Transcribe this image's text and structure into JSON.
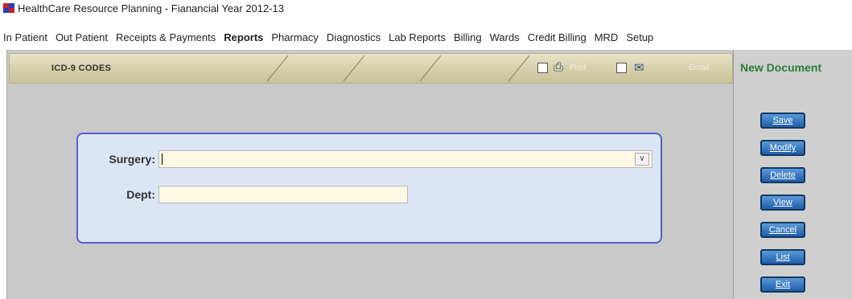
{
  "window": {
    "title": "HealthCare Resource Planning - Fianancial Year 2012-13"
  },
  "menu": [
    {
      "label": "In Patient",
      "bold": false
    },
    {
      "label": "Out Patient",
      "bold": false
    },
    {
      "label": "Receipts & Payments",
      "bold": false
    },
    {
      "label": "Reports",
      "bold": true
    },
    {
      "label": "Pharmacy",
      "bold": false
    },
    {
      "label": "Diagnostics",
      "bold": false
    },
    {
      "label": "Lab Reports",
      "bold": false
    },
    {
      "label": "Billing",
      "bold": false
    },
    {
      "label": "Wards",
      "bold": false
    },
    {
      "label": "Credit Billing",
      "bold": false
    },
    {
      "label": "MRD",
      "bold": false
    },
    {
      "label": "Setup",
      "bold": false
    }
  ],
  "ribbon": {
    "title": "ICD-9 CODES",
    "print_label": "Print",
    "email_label": "Email"
  },
  "form": {
    "surgery": {
      "label": "Surgery:",
      "value": ""
    },
    "dept": {
      "label": "Dept:",
      "value": ""
    }
  },
  "side": {
    "heading": "New Document",
    "buttons": {
      "save": "Save",
      "modify": "Modify",
      "delete": "Delete",
      "view": "View",
      "cancel": "Cancel",
      "list": "List",
      "exit": "Exit"
    }
  },
  "colors": {
    "accent_green": "#2e7d3a",
    "button_blue": "#1f5ea8",
    "panel_border": "#5560c8",
    "input_bg": "#fff8e3"
  }
}
